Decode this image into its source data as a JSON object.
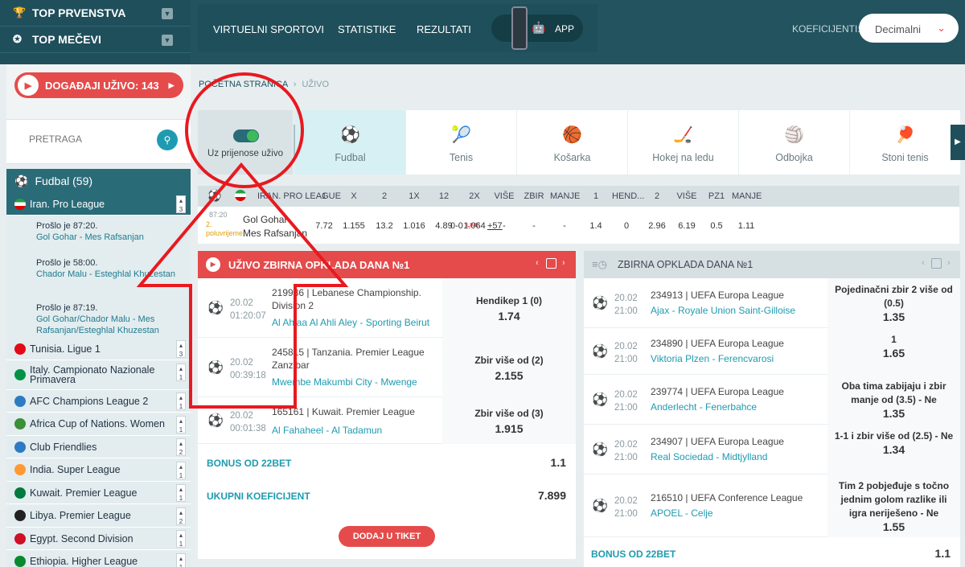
{
  "sidebar": {
    "top_items": [
      {
        "label": "TOP PRVENSTVA",
        "icon": "trophy-icon"
      },
      {
        "label": "TOP MEČEVI",
        "icon": "rosette-icon"
      }
    ],
    "live_button": "DOGAĐAJI UŽIVO: 143",
    "search_placeholder": "PRETRAGA",
    "sport": "Fudbal (59)",
    "active_league": {
      "name": "Iran. Pro League",
      "count": "3"
    },
    "matches": [
      {
        "time": "Prošlo je 87:20.",
        "teams": "Gol Gohar - Mes Rafsanjan"
      },
      {
        "time": "Prošlo je 58:00.",
        "teams": "Chador Malu - Esteghlal Khuzestan"
      },
      {
        "time": "Prošlo je 87:19.",
        "teams": "Gol Gohar/Chador Malu - Mes Rafsanjan/Esteghlal Khuzestan"
      }
    ],
    "leagues": [
      {
        "name": "Tunisia. Ligue 1",
        "count": "3",
        "color": "#e30a17"
      },
      {
        "name": "Italy. Campionato Nazionale Primavera",
        "count": "1",
        "color": "#009246"
      },
      {
        "name": "AFC Champions League 2",
        "count": "1",
        "color": "#2e7bc4"
      },
      {
        "name": "Africa Cup of Nations. Women",
        "count": "1",
        "color": "#3a8f3a"
      },
      {
        "name": "Club Friendlies",
        "count": "2",
        "color": "#2e7bc4"
      },
      {
        "name": "India. Super League",
        "count": "1",
        "color": "#ff9933"
      },
      {
        "name": "Kuwait. Premier League",
        "count": "1",
        "color": "#007a3d"
      },
      {
        "name": "Libya. Premier League",
        "count": "2",
        "color": "#222222"
      },
      {
        "name": "Egypt. Second Division",
        "count": "1",
        "color": "#ce1126"
      },
      {
        "name": "Ethiopia. Higher League",
        "count": "1",
        "color": "#078930"
      }
    ]
  },
  "topnav": {
    "links": [
      "VIRTUELNI SPORTOVI",
      "STATISTIKE",
      "REZULTATI"
    ],
    "app": "APP",
    "odds_label": "KOEFICIJENTI:",
    "odds_value": "Decimalni"
  },
  "breadcrumb": {
    "home": "POČETNA STRANICA",
    "sep": "›",
    "current": "UŽIVO"
  },
  "live_toggle": {
    "label": "Uz prijenose uživo"
  },
  "sport_tabs": [
    {
      "label": "Fudbal",
      "icon": "soccer-ball-icon",
      "glyph": "⚽"
    },
    {
      "label": "Tenis",
      "icon": "tennis-icon",
      "glyph": "🎾"
    },
    {
      "label": "Košarka",
      "icon": "basketball-icon",
      "glyph": "🏀"
    },
    {
      "label": "Hokej na ledu",
      "icon": "hockey-icon",
      "glyph": "🏒"
    },
    {
      "label": "Odbojka",
      "icon": "volleyball-icon",
      "glyph": "🏐"
    },
    {
      "label": "Stoni tenis",
      "icon": "table-tennis-icon",
      "glyph": "🏓"
    }
  ],
  "table": {
    "league": "IRAN. PRO LEAGUE",
    "headers": [
      "1",
      "X",
      "2",
      "1X",
      "12",
      "2X",
      "VIŠE",
      "ZBIR",
      "MANJE",
      "1",
      "HEND...",
      "2",
      "VIŠE",
      "PZ1",
      "MANJE"
    ],
    "row": {
      "time": "87:20",
      "period": "2. poluvrijeme",
      "home": "Gol Gohar",
      "away": "Mes Rafsanjan",
      "score": "0-0",
      "live": "LIVE",
      "more": "+57",
      "odds": [
        "7.72",
        "1.155",
        "13.2",
        "1.016",
        "4.89",
        "1.064",
        "-",
        "-",
        "-",
        "1.4",
        "0",
        "2.96",
        "6.19",
        "0.5",
        "1.11"
      ]
    }
  },
  "live_combo": {
    "title": "UŽIVO ZBIRNA OPKLADA DANA №1",
    "rows": [
      {
        "date": "20.02",
        "time": "01:20:07",
        "desc": "219986 | Lebanese Championship. Division 2",
        "home": "Al Ahlaa Al Ahli Aley",
        "away": "Sporting Beirut",
        "market": "Hendikep 1 (0)",
        "odd": "1.74"
      },
      {
        "date": "20.02",
        "time": "00:39:18",
        "desc": "245815 | Tanzania. Premier League Zanzibar",
        "home": "Mwembe Makumbi City",
        "away": "Mwenge",
        "market": "Zbir više od (2)",
        "odd": "2.155"
      },
      {
        "date": "20.02",
        "time": "00:01:38",
        "desc": "165161 | Kuwait. Premier League",
        "home": "Al Fahaheel",
        "away": "Al Tadamun",
        "market": "Zbir više od (3)",
        "odd": "1.915"
      }
    ],
    "bonus_label": "BONUS OD 22BET",
    "bonus_value": "1.1",
    "total_label": "UKUPNI KOEFICIJENT",
    "total_value": "7.899",
    "add_button": "DODAJ U TIKET"
  },
  "pre_combo": {
    "title": "ZBIRNA OPKLADA DANA №1",
    "rows": [
      {
        "date": "20.02",
        "time": "21:00",
        "desc": "234913 | UEFA Europa League",
        "home": "Ajax",
        "away": "Royale Union Saint-Gilloise",
        "market": "Pojedinačni zbir 2 više od (0.5)",
        "odd": "1.35"
      },
      {
        "date": "20.02",
        "time": "21:00",
        "desc": "234890 | UEFA Europa League",
        "home": "Viktoria Plzen",
        "away": "Ferencvarosi",
        "market": "1",
        "odd": "1.65"
      },
      {
        "date": "20.02",
        "time": "21:00",
        "desc": "239774 | UEFA Europa League",
        "home": "Anderlecht",
        "away": "Fenerbahce",
        "market": "Oba tima zabijaju i zbir manje od (3.5) - Ne",
        "odd": "1.35"
      },
      {
        "date": "20.02",
        "time": "21:00",
        "desc": "234907 | UEFA Europa League",
        "home": "Real Sociedad",
        "away": "Midtjylland",
        "market": "1-1 i zbir više od (2.5) - Ne",
        "odd": "1.34"
      },
      {
        "date": "20.02",
        "time": "21:00",
        "desc": "216510 | UEFA Conference League",
        "home": "APOEL",
        "away": "Celje",
        "market": "Tim 2 pobjeđuje s točno jednim golom razlike ili igra neriješeno - Ne",
        "odd": "1.55"
      }
    ],
    "bonus_label": "BONUS OD 22BET",
    "bonus_value": "1.1"
  },
  "colors": {
    "accent": "#e54b4b",
    "teal": "#1f4f5b",
    "link": "#1e9bb0",
    "annotation": "#e8191f"
  }
}
